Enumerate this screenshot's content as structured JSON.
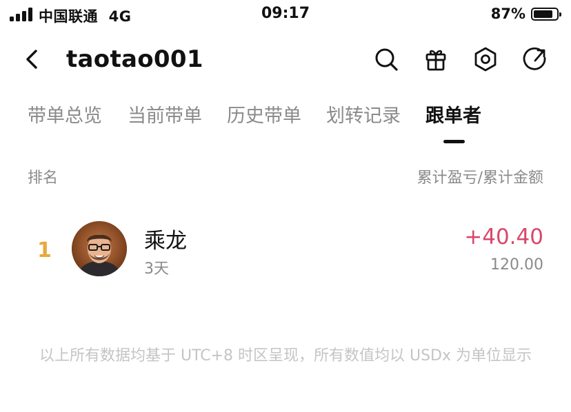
{
  "status_bar": {
    "carrier": "中国联通",
    "network": "4G",
    "time": "09:17",
    "battery_pct_text": "87%",
    "battery_level": 0.87
  },
  "header": {
    "title": "taotao001",
    "icons": [
      "back-arrow-icon",
      "search-icon",
      "gift-icon",
      "settings-icon",
      "share-icon"
    ]
  },
  "tabs": [
    {
      "label": "带单总览",
      "active": false
    },
    {
      "label": "当前带单",
      "active": false
    },
    {
      "label": "历史带单",
      "active": false
    },
    {
      "label": "划转记录",
      "active": false
    },
    {
      "label": "跟单者",
      "active": true
    }
  ],
  "columns": {
    "left": "排名",
    "right": "累计盈亏/累计金额"
  },
  "followers": [
    {
      "rank": "1",
      "name": "乘龙",
      "days": "3天",
      "pnl": "+40.40",
      "amount": "120.00"
    }
  ],
  "footnote": "以上所有数据均基于 UTC+8 时区呈现，所有数值均以 USDx 为单位显示",
  "colors": {
    "accent_text": "#111111",
    "muted_text": "#8a8a8a",
    "positive_pnl": "#d9476b",
    "rank_gold": "#e8a93b"
  }
}
